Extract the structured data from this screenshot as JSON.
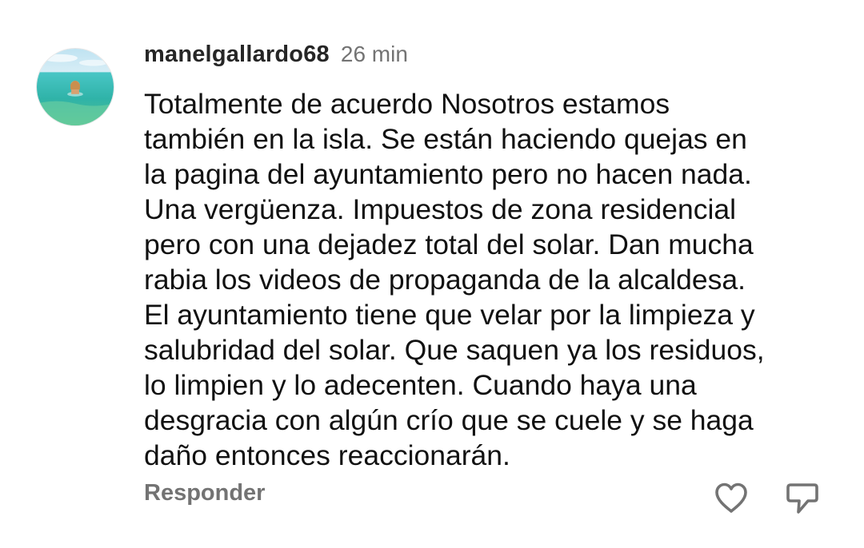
{
  "comment": {
    "username": "manelgallardo68",
    "time": "26 min",
    "lines": [
      "Totalmente de acuerdo Nosotros estamos",
      "también en la isla. Se están haciendo quejas en",
      "la pagina del ayuntamiento pero no hacen nada.",
      "Una vergüenza. Impuestos de zona residencial",
      "pero con una dejadez total del solar. Dan mucha",
      "rabia los videos de propaganda de la alcaldesa.",
      "El ayuntamiento tiene que velar por la limpieza y",
      "salubridad del solar. Que saquen ya los residuos,",
      "lo limpien y lo adecenten. Cuando haya una",
      "desgracia con algún crío que se cuele y se haga",
      "daño entonces reaccionarán."
    ],
    "reply_label": "Responder"
  },
  "icons": {
    "like": "heart-icon",
    "share": "share-icon"
  },
  "colors": {
    "username": "#262626",
    "secondary": "#737373",
    "text": "#111111"
  }
}
